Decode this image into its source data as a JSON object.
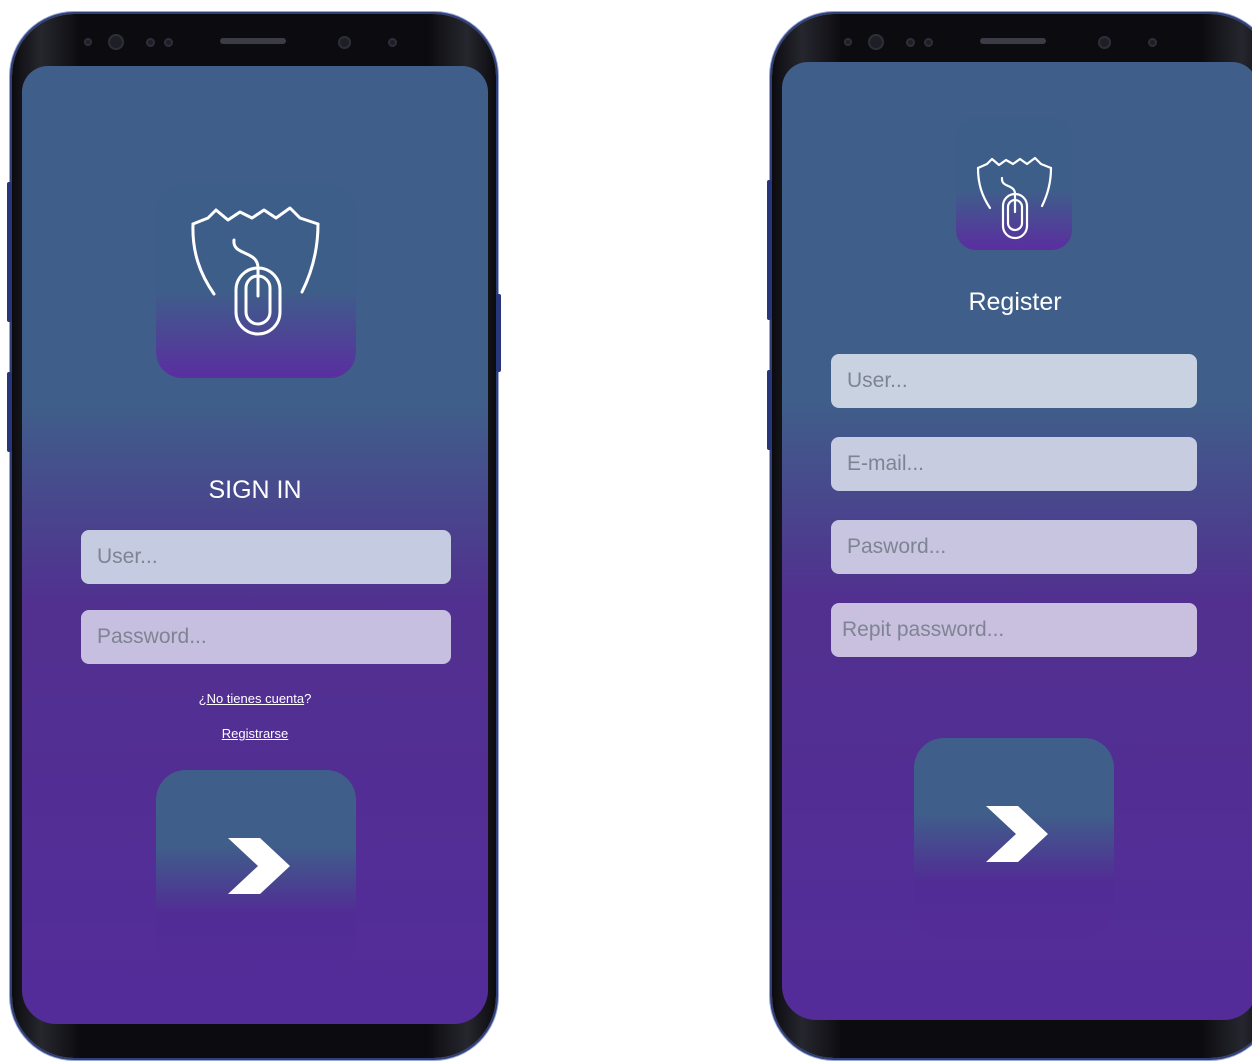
{
  "colors": {
    "screen_top": "#3f5f8a",
    "screen_bottom": "#542c9a",
    "field_bg": "#c9d2e2",
    "text": "#ffffff"
  },
  "icons": {
    "logo": "shield-mouse-icon",
    "submit": "chevron-right-icon"
  },
  "signin": {
    "title": "SIGN IN",
    "user_placeholder": "User...",
    "password_placeholder": "Password...",
    "no_account_prefix": "¿",
    "no_account_link": "No tienes cuenta",
    "no_account_suffix": "?",
    "register_link": "Registrarse"
  },
  "register": {
    "title": "Register",
    "user_placeholder": "User...",
    "email_placeholder": "E-mail...",
    "password_placeholder": "Pasword...",
    "repeat_password_placeholder": "Repit password..."
  }
}
